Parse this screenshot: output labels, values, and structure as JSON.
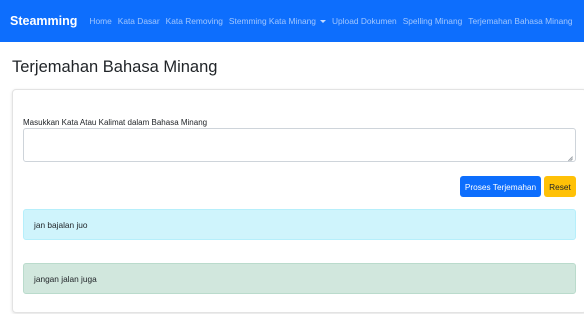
{
  "navbar": {
    "brand": "Steamming",
    "items": [
      {
        "label": "Home"
      },
      {
        "label": "Kata Dasar"
      },
      {
        "label": "Kata Removing"
      },
      {
        "label": "Stemming Kata Minang"
      },
      {
        "label": "Upload Dokumen"
      },
      {
        "label": "Spelling Minang"
      },
      {
        "label": "Terjemahan Bahasa Minang"
      }
    ],
    "dropdown_icon": "caret-down-icon"
  },
  "page": {
    "title": "Terjemahan Bahasa Minang"
  },
  "form": {
    "label": "Masukkan Kata Atau Kalimat dalam Bahasa Minang",
    "input_value": "",
    "process_button": "Proses Terjemahan",
    "reset_button": "Reset"
  },
  "results": {
    "input_text": "jan bajalan juo",
    "translated_text": "jangan jalan juga"
  },
  "colors": {
    "navbar": "#0d6efd",
    "primary": "#0d6efd",
    "warning": "#ffc107",
    "info_bg": "#cff4fc",
    "success_bg": "#d1e7dd"
  }
}
